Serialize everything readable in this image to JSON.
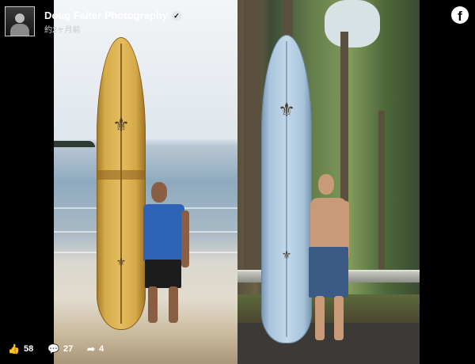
{
  "header": {
    "page_name": "Doug Falter Photography",
    "time_ago": "約2ヶ月前",
    "verified_icon": "verified-badge-icon",
    "platform_icon": "facebook-icon"
  },
  "photos": {
    "left_board_logo": "⚜",
    "right_board_logo": "⚜"
  },
  "footer": {
    "likes_count": "58",
    "comments_count": "27",
    "shares_count": "4",
    "like_icon": "thumbs-up-icon",
    "comment_icon": "comment-icon",
    "share_icon": "share-arrow-icon"
  },
  "colors": {
    "background": "#000000",
    "text": "#ffffff"
  }
}
